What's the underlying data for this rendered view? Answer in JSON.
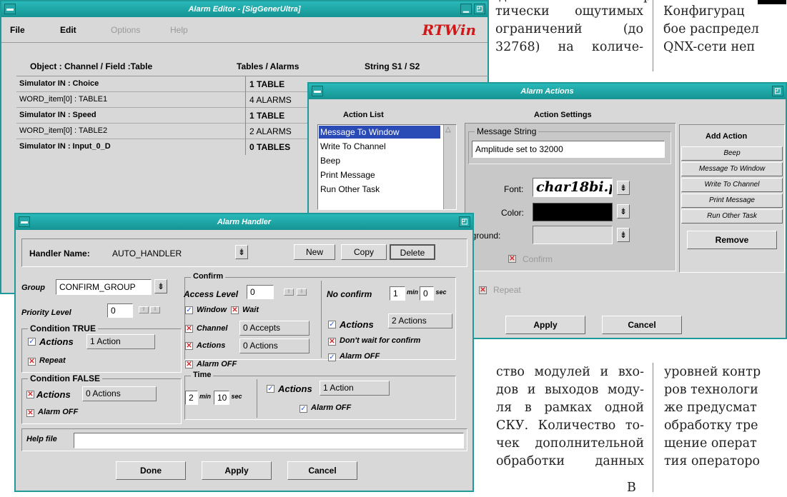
{
  "magazine": {
    "col1": [
      "тически ощутимых",
      "ограничений (до",
      "32768) на количе-"
    ],
    "col2": [
      "Конфигурац",
      "бое распредел",
      "QNX-сети неп"
    ],
    "col3": [
      "ство модулей и вхо-",
      "дов и выходов моду-",
      "ля в рамках одной",
      "СКУ. Количество то-",
      "чек дополнительной",
      "обработки данных"
    ],
    "col4": [
      "уровней контр",
      "ров технологи",
      "же предусмат",
      "обработку тре",
      "щение операт",
      "тия операторо"
    ],
    "stray_chars": {
      "top_right_a": "д",
      "top_right_b": "р",
      "bottom": "В"
    }
  },
  "alarm_editor": {
    "title": "Alarm Editor - [SigGenerUltra]",
    "menu": [
      "File",
      "Edit",
      "Options",
      "Help"
    ],
    "brand": "RTWin",
    "headers": [
      "Object : Channel / Field :Table",
      "Tables / Alarms",
      "String S1 / S2"
    ],
    "rows": [
      {
        "object": "Simulator IN : Choice",
        "tables": "1 TABLE",
        "bold": true
      },
      {
        "object": "WORD_item[0] : TABLE1",
        "tables": "4 ALARMS",
        "bold": false
      },
      {
        "object": "Simulator IN : Speed",
        "tables": "1 TABLE",
        "bold": true
      },
      {
        "object": "WORD_item[0] : TABLE2",
        "tables": "2 ALARMS",
        "bold": false
      },
      {
        "object": "Simulator IN : Input_0_D",
        "tables": "0 TABLES",
        "bold": true
      }
    ]
  },
  "alarm_actions": {
    "title": "Alarm Actions",
    "action_list_label": "Action List",
    "action_settings_label": "Action Settings",
    "actions": [
      "Message To Window",
      "Write To Channel",
      "Beep",
      "Print Message",
      "Run Other Task"
    ],
    "message_string_label": "Message String",
    "message_string": "Amplitude set to 32000",
    "font_label": "Font:",
    "font_value": "char18bi.p",
    "color_label": "Color:",
    "background_label": "Background:",
    "confirm_label": "Confirm",
    "repeat_label": "Repeat",
    "add_action_label": "Add Action",
    "add_actions": [
      "Beep",
      "Message To Window",
      "Write To Channel",
      "Print Message",
      "Run Other Task"
    ],
    "remove_label": "Remove",
    "apply_label": "Apply",
    "cancel_label": "Cancel",
    "colors": {
      "color_swatch": "#000000",
      "background_swatch": "#d8d8d8"
    }
  },
  "alarm_handler": {
    "title": "Alarm Handler",
    "handler_name_label": "Handler Name:",
    "handler_name": "AUTO_HANDLER",
    "new_label": "New",
    "copy_label": "Copy",
    "delete_label": "Delete",
    "group_label": "Group",
    "group_value": "CONFIRM_GROUP",
    "priority_label": "Priority Level",
    "priority_value": "0",
    "cond_true_label": "Condition TRUE",
    "cond_true_actions_label": "Actions",
    "cond_true_actions_value": "1 Action",
    "cond_true_repeat_label": "Repeat",
    "cond_false_label": "Condition FALSE",
    "cond_false_actions_label": "Actions",
    "cond_false_actions_value": "0 Actions",
    "cond_false_alarm_off_label": "Alarm OFF",
    "confirm_label": "Confirm",
    "access_level_label": "Access Level",
    "access_level_value": "0",
    "window_label": "Window",
    "wait_label": "Wait",
    "channel_label": "Channel",
    "channel_value": "0 Accepts",
    "confirm_actions_label": "Actions",
    "confirm_actions_value": "0 Actions",
    "confirm_alarm_off_label": "Alarm OFF",
    "no_confirm_label": "No confirm",
    "no_confirm_min": "1",
    "no_confirm_sec": "0",
    "min_unit": "min",
    "sec_unit": "sec",
    "nc_actions_label": "Actions",
    "nc_actions_value": "2 Actions",
    "dont_wait_label": "Don't wait for confirm",
    "nc_alarm_off_label": "Alarm OFF",
    "time_label": "Time",
    "time_min": "2",
    "time_sec": "10",
    "time_actions_label": "Actions",
    "time_actions_value": "1 Action",
    "time_alarm_off_label": "Alarm OFF",
    "help_file_label": "Help file",
    "help_file_value": "",
    "done_label": "Done",
    "apply_label": "Apply",
    "cancel_label": "Cancel"
  }
}
